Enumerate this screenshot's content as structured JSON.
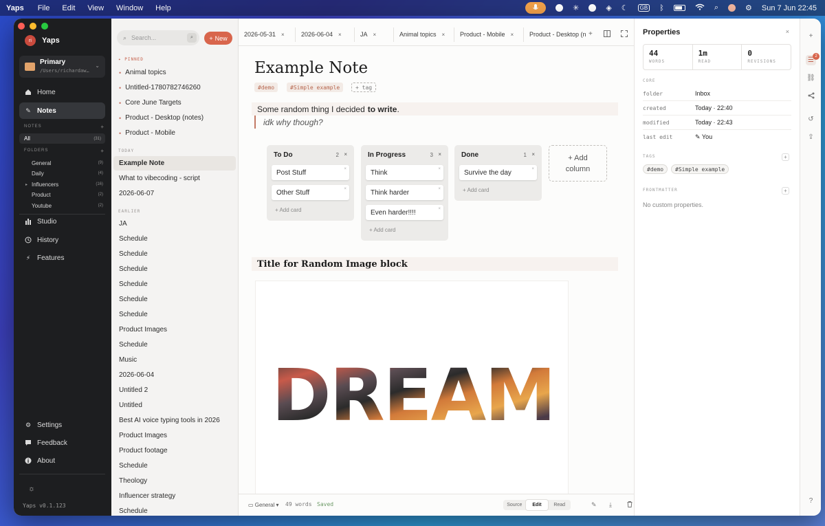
{
  "menubar": {
    "app": "Yaps",
    "menus": [
      "File",
      "Edit",
      "View",
      "Window",
      "Help"
    ],
    "keyboard": "GB",
    "datetime": "Sun 7 Jun  22:45"
  },
  "sidebar": {
    "app_name": "Yaps",
    "avatar_initials": "ri",
    "workspace": {
      "title": "Primary",
      "path": "/Users/richardaw…"
    },
    "nav": {
      "home": "Home",
      "notes": "Notes",
      "studio": "Studio",
      "history": "History",
      "features": "Features",
      "settings": "Settings",
      "feedback": "Feedback",
      "about": "About"
    },
    "notes_section": "NOTES",
    "all": {
      "label": "All",
      "count": "(31)"
    },
    "folders_section": "FOLDERS",
    "folders": [
      {
        "name": "General",
        "count": "(9)"
      },
      {
        "name": "Daily",
        "count": "(4)"
      },
      {
        "name": "Influencers",
        "count": "(16)"
      },
      {
        "name": "Product",
        "count": "(2)"
      },
      {
        "name": "Youtube",
        "count": "(2)"
      }
    ],
    "version": "Yaps v0.1.123"
  },
  "list": {
    "search_placeholder": "Search...",
    "new_label": "New",
    "pinned_label": "PINNED",
    "pinned": [
      "Animal topics",
      "Untitled-1780782746260",
      "Core June Targets",
      "Product - Desktop (notes)",
      "Product - Mobile"
    ],
    "today_label": "TODAY",
    "today": [
      "Example Note",
      "What to vibecoding - script",
      "2026-06-07"
    ],
    "earlier_label": "EARLIER",
    "earlier": [
      "JA",
      "Schedule",
      "Schedule",
      "Schedule",
      "Schedule",
      "Schedule",
      "Schedule",
      "Product Images",
      "Schedule",
      "Music",
      "2026-06-04",
      "Untitled 2",
      "Untitled",
      "Best AI voice typing tools in 2026",
      "Product Images",
      "Product footage",
      "Schedule",
      "Theology",
      "Influencer strategy",
      "Schedule"
    ]
  },
  "tabs": [
    "2026-05-31",
    "2026-06-04",
    "JA",
    "Animal topics",
    "Product - Mobile",
    "Product - Desktop (n"
  ],
  "doc": {
    "title": "Example Note",
    "tags": [
      "#demo",
      "#Simple example"
    ],
    "add_tag": "+ tag",
    "para_plain": "Some random thing I decided",
    "para_bold": "to write",
    "para_end": ".",
    "quote": "idk why though?",
    "kanban": [
      {
        "title": "To Do",
        "count": "2",
        "cards": [
          "Post Stuff",
          "Other Stuff"
        ]
      },
      {
        "title": "In Progress",
        "count": "3",
        "cards": [
          "Think",
          "Think harder",
          "Even harder!!!!"
        ]
      },
      {
        "title": "Done",
        "count": "1",
        "cards": [
          "Survive the day"
        ]
      }
    ],
    "add_card": "+ Add card",
    "add_column": [
      "+ Add",
      "column"
    ],
    "heading": "Title for Random Image block",
    "image_word": "DREAM"
  },
  "footer": {
    "folder": "General",
    "words": "49 words",
    "saved": "Saved",
    "modes": [
      "Source",
      "Edit",
      "Read"
    ],
    "active_mode": "Edit"
  },
  "props": {
    "title": "Properties",
    "stats": [
      {
        "value": "44",
        "label": "WORDS"
      },
      {
        "value": "1m",
        "label": "READ"
      },
      {
        "value": "0",
        "label": "REVISIONS"
      }
    ],
    "core_label": "CORE",
    "rows": [
      {
        "key": "folder",
        "value": "Inbox"
      },
      {
        "key": "created",
        "value": "Today · 22:40"
      },
      {
        "key": "modified",
        "value": "Today · 22:43"
      },
      {
        "key": "last edit",
        "value": "You"
      }
    ],
    "tags_label": "TAGS",
    "tags": [
      "#demo",
      "#Simple example"
    ],
    "frontmatter_label": "FRONTMATTER",
    "frontmatter_empty": "No custom properties."
  },
  "rail": {
    "badge": "2",
    "help": "?"
  },
  "colors": {
    "accent": "#d8654c",
    "sidebar_bg": "#1d1e20",
    "list_bg": "#f4f3f2"
  }
}
